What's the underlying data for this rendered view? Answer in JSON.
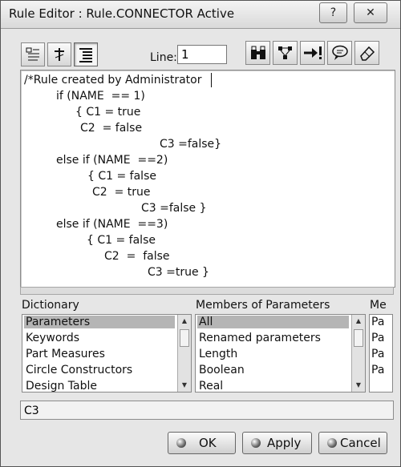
{
  "window": {
    "title": "Rule Editor : Rule.CONNECTOR Active",
    "help_glyph": "?",
    "close_glyph": "✕"
  },
  "toolbar": {
    "line_label": "Line:",
    "line_value": "1",
    "left_icons": [
      "list-outline-icon",
      "pin-icon",
      "indent-icon"
    ],
    "right_icons": [
      "binoculars-icon",
      "network-icon",
      "arrow-warning-icon",
      "speech-bubble-icon",
      "eraser-icon"
    ]
  },
  "editor": {
    "lines": [
      "/*Rule created by Administrator",
      "if (NAME  == 1)",
      "{ C1 = true",
      "C2  = false",
      "C3 =false}",
      "else if (NAME  ==2)",
      "{ C1 = false",
      "C2  = true",
      "C3 =false }",
      "else if (NAME  ==3)",
      "{ C1 = false",
      "C2  =  false",
      "C3 =true }"
    ]
  },
  "dictionary": {
    "label": "Dictionary",
    "items": [
      "Parameters",
      "Keywords",
      "Part Measures",
      "Circle Constructors",
      "Design Table"
    ],
    "selected": "Parameters"
  },
  "members": {
    "label": "Members of Parameters",
    "items": [
      "All",
      "Renamed parameters",
      "Length",
      "Boolean",
      "Real"
    ],
    "selected": "All"
  },
  "third_panel": {
    "label": "Me",
    "items": [
      "Pa",
      "Pa",
      "Pa",
      "Pa"
    ]
  },
  "status": {
    "text": "C3"
  },
  "buttons": {
    "ok": "OK",
    "apply": "Apply",
    "cancel": "Cancel"
  }
}
